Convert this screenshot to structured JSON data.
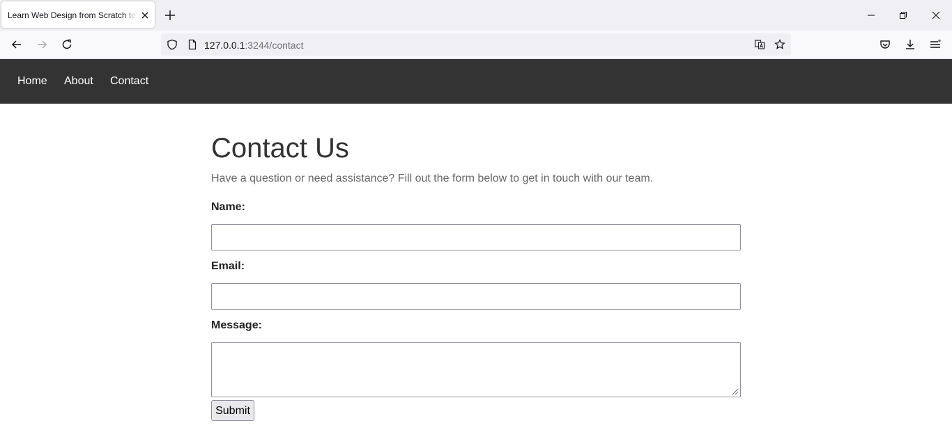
{
  "browser": {
    "tab_title": "Learn Web Design from Scratch to Pro",
    "url_host": "127.0.0.1",
    "url_rest": ":3244/contact"
  },
  "site_nav": {
    "items": [
      {
        "label": "Home"
      },
      {
        "label": "About"
      },
      {
        "label": "Contact"
      }
    ]
  },
  "contact": {
    "title": "Contact Us",
    "intro": "Have a question or need assistance? Fill out the form below to get in touch with our team.",
    "name_label": "Name:",
    "email_label": "Email:",
    "message_label": "Message:",
    "name_value": "",
    "email_value": "",
    "message_value": "",
    "submit_label": "Submit"
  },
  "colors": {
    "nav_bg": "#333333",
    "title": "#333333",
    "intro": "#666666"
  }
}
